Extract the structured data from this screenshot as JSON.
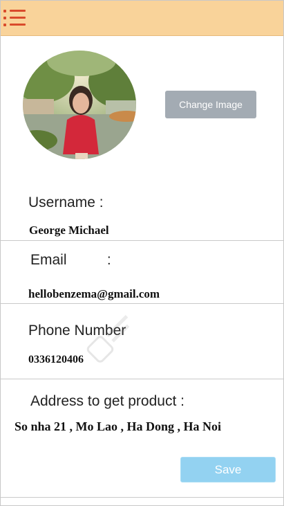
{
  "header": {
    "menu_icon": "menu-list-icon",
    "accent_color": "#d94a2b",
    "background_color": "#f9d39a"
  },
  "profile": {
    "change_image_label": "Change Image"
  },
  "fields": {
    "username_label": "Username :",
    "username_value": "George Michael",
    "email_label": "Email          :",
    "email_value": "hellobenzema@gmail.com",
    "phone_label": "Phone Number",
    "phone_value": "0336120406",
    "address_label": "Address to get product :",
    "address_value": "So nha 21 , Mo Lao , Ha Dong , Ha Noi"
  },
  "actions": {
    "save_label": "Save",
    "save_color": "#93d2f1"
  }
}
